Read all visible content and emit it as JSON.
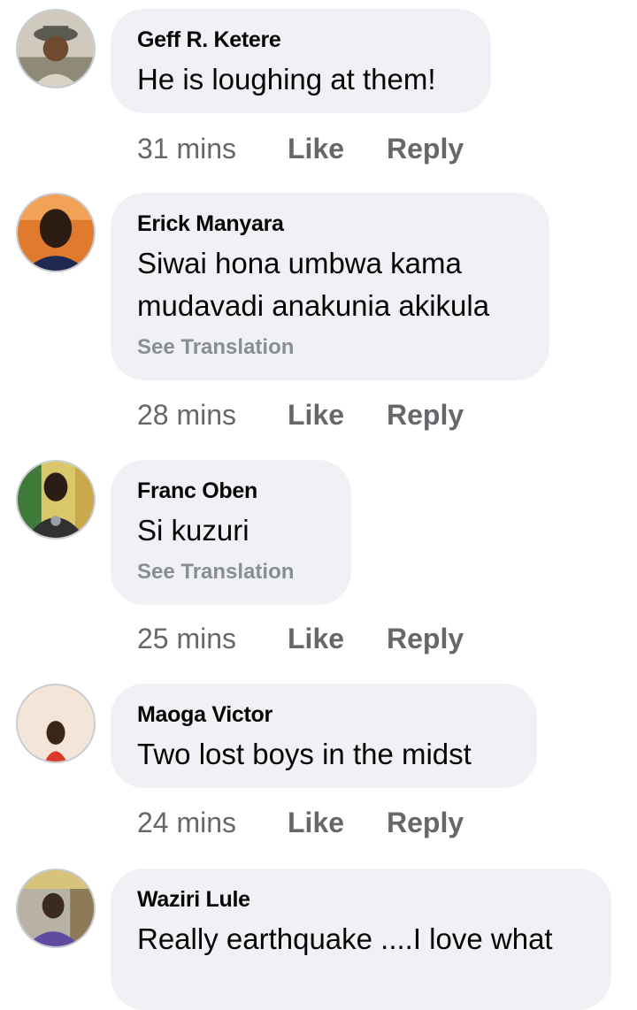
{
  "comments": [
    {
      "author": "Geff R. Ketere",
      "lines": [
        "He is loughing at them!"
      ],
      "time": "31 mins",
      "like_label": "Like",
      "reply_label": "Reply"
    },
    {
      "author": "Erick Manyara",
      "lines": [
        "Siwai hona umbwa kama",
        "mudavadi anakunia akikula"
      ],
      "see_translation": "See Translation",
      "time": "28 mins",
      "like_label": "Like",
      "reply_label": "Reply"
    },
    {
      "author": "Franc Oben",
      "lines": [
        "Si kuzuri"
      ],
      "see_translation": "See Translation",
      "time": "25 mins",
      "like_label": "Like",
      "reply_label": "Reply"
    },
    {
      "author": "Maoga Victor",
      "lines": [
        "Two lost boys in the midst"
      ],
      "time": "24 mins",
      "like_label": "Like",
      "reply_label": "Reply"
    },
    {
      "author": "Waziri Lule",
      "lines": [
        "Really earthquake ....I love what"
      ]
    }
  ],
  "colors": {
    "bubble_bg": "#eff1f4",
    "meta_text": "#65676b",
    "translation_text": "#8a8d91"
  }
}
